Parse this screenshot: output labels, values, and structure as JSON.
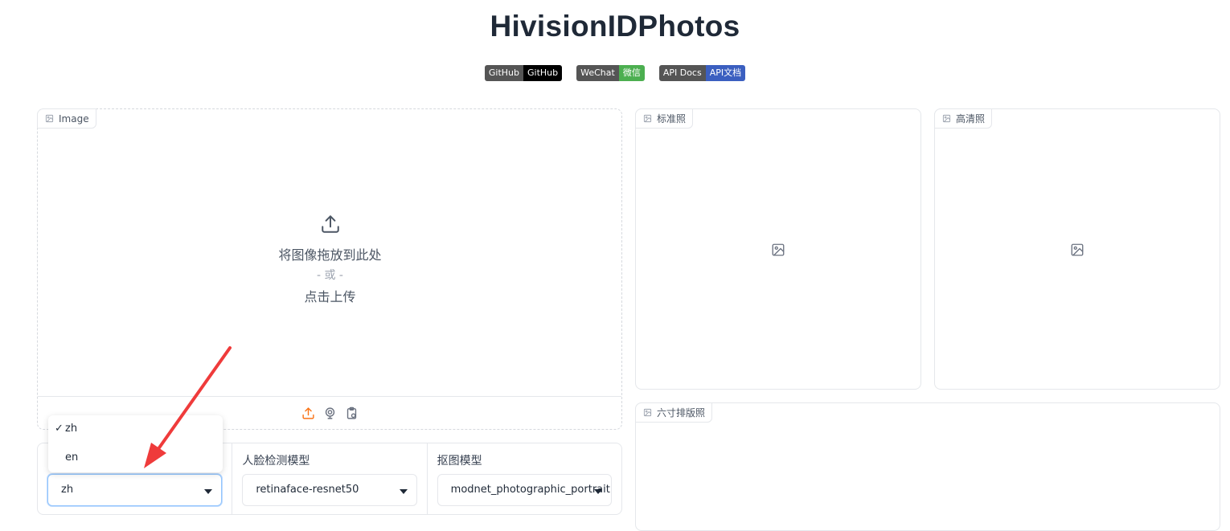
{
  "header": {
    "title": "HivisionIDPhotos"
  },
  "badges": [
    {
      "left": "GitHub",
      "right": "GitHub",
      "color": "#000000"
    },
    {
      "left": "WeChat",
      "right": "微信",
      "color": "#4caf50"
    },
    {
      "left": "API Docs",
      "right": "API文档",
      "color": "#3b5fc0"
    }
  ],
  "input_panel": {
    "label": "Image",
    "drop_text": "将图像拖放到此处",
    "or_text": "- 或 -",
    "click_text": "点击上传"
  },
  "outputs": {
    "standard_label": "标准照",
    "hd_label": "高清照",
    "layout_label": "六寸排版照"
  },
  "settings": {
    "language": {
      "value": "zh",
      "options": [
        "zh",
        "en"
      ],
      "selected_mark": "✓"
    },
    "face_model": {
      "label": "人脸检测模型",
      "value": "retinaface-resnet50"
    },
    "matting_model": {
      "label": "抠图模型",
      "value": "modnet_photographic_portrait"
    }
  },
  "colors": {
    "accent": "#f97316",
    "annotation_arrow": "#ef3b3b"
  }
}
